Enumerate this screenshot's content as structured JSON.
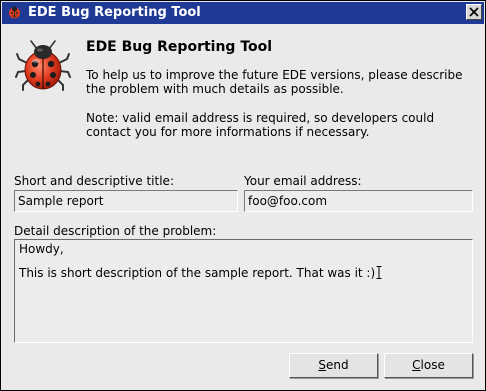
{
  "window": {
    "title": "EDE Bug Reporting Tool"
  },
  "header": {
    "heading": "EDE Bug Reporting Tool",
    "intro": "To help us to improve the future EDE versions, please describe the problem with much details as possible.",
    "note": "Note: valid email address is required, so developers could contact you for more informations if necessary."
  },
  "form": {
    "title_label": "Short and descriptive title:",
    "title_value": "Sample report",
    "email_label": "Your email address:",
    "email_value": "foo@foo.com",
    "description_label": "Detail description of the problem:",
    "description_lines": [
      "Howdy,",
      "",
      "This is short description of the sample report. That was it :)"
    ]
  },
  "buttons": {
    "send_label_first": "S",
    "send_label_rest": "end",
    "close_label_first": "C",
    "close_label_rest": "lose"
  },
  "icons": {
    "app": "ladybug-icon",
    "logo": "ladybug-logo",
    "close": "close-icon"
  },
  "colors": {
    "titlebar": "#1f3a94",
    "ladybug": "#e23b1f"
  }
}
